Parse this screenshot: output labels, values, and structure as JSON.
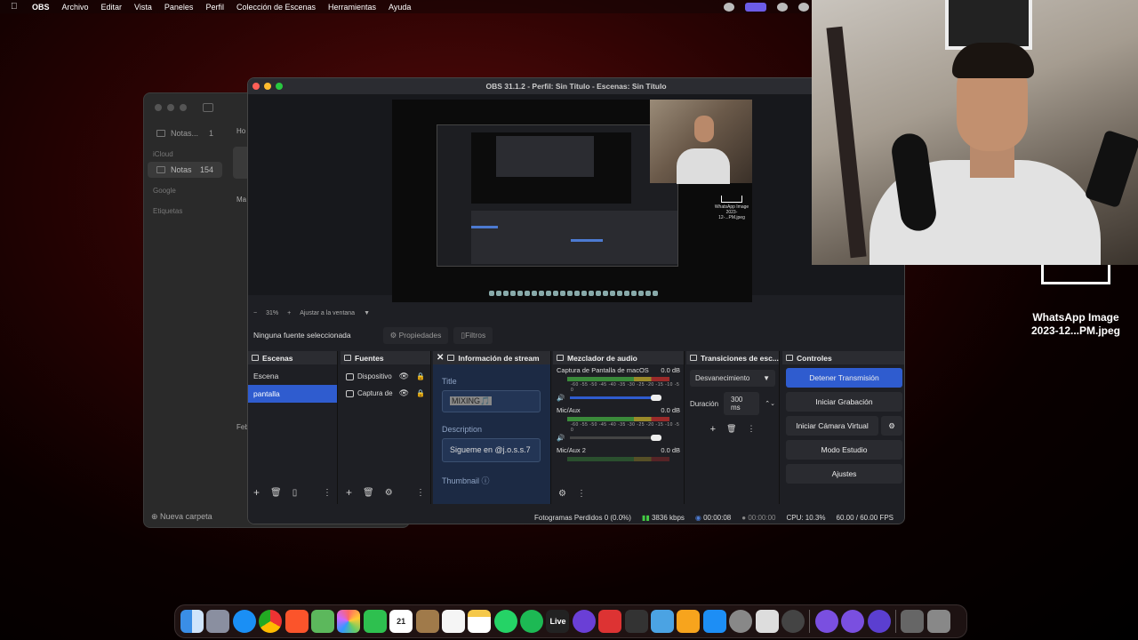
{
  "menubar": {
    "app": "OBS",
    "items": [
      "Archivo",
      "Editar",
      "Vista",
      "Paneles",
      "Perfil",
      "Colección de Escenas",
      "Herramientas",
      "Ayuda"
    ]
  },
  "notes": {
    "folder_notas": "Notas...",
    "folder_notas_count": "1",
    "group_icloud": "iCloud",
    "folder_icloud_notas": "Notas",
    "folder_icloud_count": "154",
    "group_google": "Google",
    "group_tags": "Etiquetas",
    "peek_ho": "Ho",
    "peek_ma": "Ma",
    "peek_feb": "Feb",
    "new_folder": "Nueva carpeta"
  },
  "obs": {
    "title": "OBS 31.1.2 - Perfil: Sin Título - Escenas: Sin Título",
    "zoom": "31%",
    "fit_label": "Ajustar a la ventana",
    "no_source": "Ninguna fuente seleccionada",
    "properties": "Propiedades",
    "filters": "Filtros",
    "scenes": {
      "header": "Escenas",
      "items": [
        "Escena",
        "pantalla"
      ]
    },
    "sources": {
      "header": "Fuentes",
      "items": [
        "Dispositivo",
        "Captura de"
      ]
    },
    "stream_info": {
      "header": "Información de stream",
      "title_label": "Title",
      "title_value": "MIXING🎵",
      "description_label": "Description",
      "description_value": "Sigueme en @j.o.s.s.7",
      "thumbnail_label": "Thumbnail"
    },
    "mixer": {
      "header": "Mezclador de audio",
      "channels": [
        {
          "name": "Captura de Pantalla de macOS",
          "db": "0.0 dB"
        },
        {
          "name": "Mic/Aux",
          "db": "0.0 dB"
        },
        {
          "name": "Mic/Aux 2",
          "db": "0.0 dB"
        }
      ],
      "ticks": "-60 -55 -50 -45 -40 -35 -30 -25 -20 -15 -10 -5 0"
    },
    "transitions": {
      "header": "Transiciones de esc...",
      "selected": "Desvanecimiento",
      "duration_label": "Duración",
      "duration_value": "300 ms"
    },
    "controls": {
      "header": "Controles",
      "stop_stream": "Detener Transmisión",
      "start_recording": "Iniciar Grabación",
      "virtual_cam": "Iniciar Cámara Virtual",
      "studio_mode": "Modo Estudio",
      "settings": "Ajustes"
    },
    "status": {
      "dropped": "Fotogramas Perdidos 0 (0.0%)",
      "bitrate": "3836 kbps",
      "stream_time": "00:00:08",
      "rec_time": "00:00:00",
      "cpu": "CPU: 10.3%",
      "fps": "60.00 / 60.00 FPS"
    }
  },
  "overlay": {
    "wa_title": "WhatsApp Image",
    "wa_sub": "2023-12...PM.jpeg",
    "preview_wa_title": "WhatsApp Image",
    "preview_wa_sub": "2023-12-...PM.jpeg"
  },
  "dock": {
    "calendar_day": "21",
    "live_label": "Live",
    "apps": [
      "finder-icon",
      "launchpad-icon",
      "safari-icon",
      "chrome-icon",
      "brave-icon",
      "maps-icon",
      "photos-icon",
      "facetime-icon",
      "calendar-icon",
      "notes-folder-icon",
      "reminders-icon",
      "notes-icon",
      "whatsapp-icon",
      "spotify-icon",
      "live-icon",
      "arc-icon",
      "angle-icon",
      "paint-icon",
      "preview-icon",
      "pages-icon",
      "appstore-icon",
      "settings-icon",
      "instruments-icon",
      "activity-icon"
    ]
  }
}
